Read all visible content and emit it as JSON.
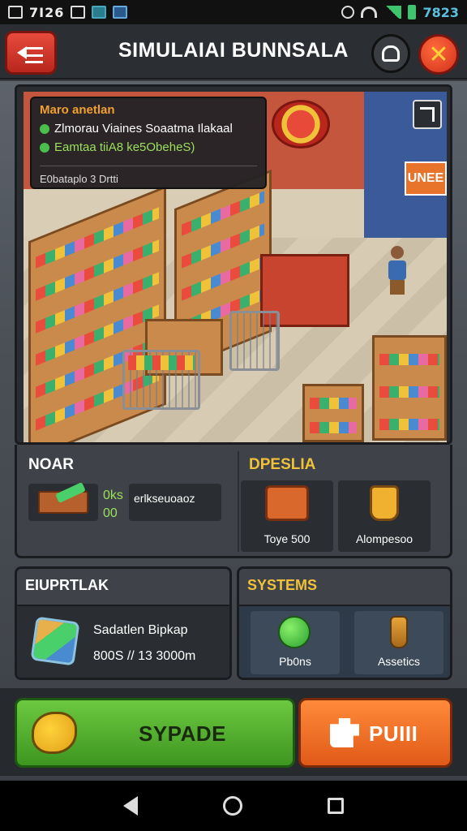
{
  "status_bar": {
    "time": "7Ⅰ26",
    "clock": "7823"
  },
  "header": {
    "title": "SIMULAIAI BUNNSALA"
  },
  "scene": {
    "info_card": {
      "title": "Maro anetlan",
      "line1": "Zlmorau Viaines Soaatma Ilakaal",
      "line2": "Eamtaa tiiA8 ke5ObeheS)",
      "footer": "E0bataplo 3 Drtti"
    },
    "exit_sign": "UNEE"
  },
  "lower": {
    "left_title": "NOAR",
    "slot_stats_1": "0ks",
    "slot_stats_2": "00",
    "slot_name": "erlkseuoaoz",
    "right_title": "DPESLIA",
    "items": [
      {
        "label": "Toye 500"
      },
      {
        "label": "Alompesoo"
      }
    ]
  },
  "sections": {
    "left": {
      "title": "EIUPRTLAK",
      "line1": "Sadatlen Bipkap",
      "line2": "800S // 13 3000m"
    },
    "right": {
      "title": "SYSTEMS",
      "cards": [
        {
          "label": "Pb0ns"
        },
        {
          "label": "Assetics"
        }
      ]
    }
  },
  "actions": {
    "primary_label": "SYPADE",
    "secondary_label": "PUIII"
  },
  "colors": {
    "accent_red": "#e84b3c",
    "accent_yellow": "#f0c23a",
    "accent_green": "#3e9620",
    "accent_orange": "#e05a18"
  },
  "icons": [
    "back-arrow-icon",
    "profile-icon",
    "close-icon",
    "expand-icon",
    "shelf-slot-icon",
    "basket-icon",
    "cup-icon",
    "cube-icon",
    "green-orb-icon",
    "flask-icon",
    "fish-icon",
    "puzzle-icon"
  ]
}
